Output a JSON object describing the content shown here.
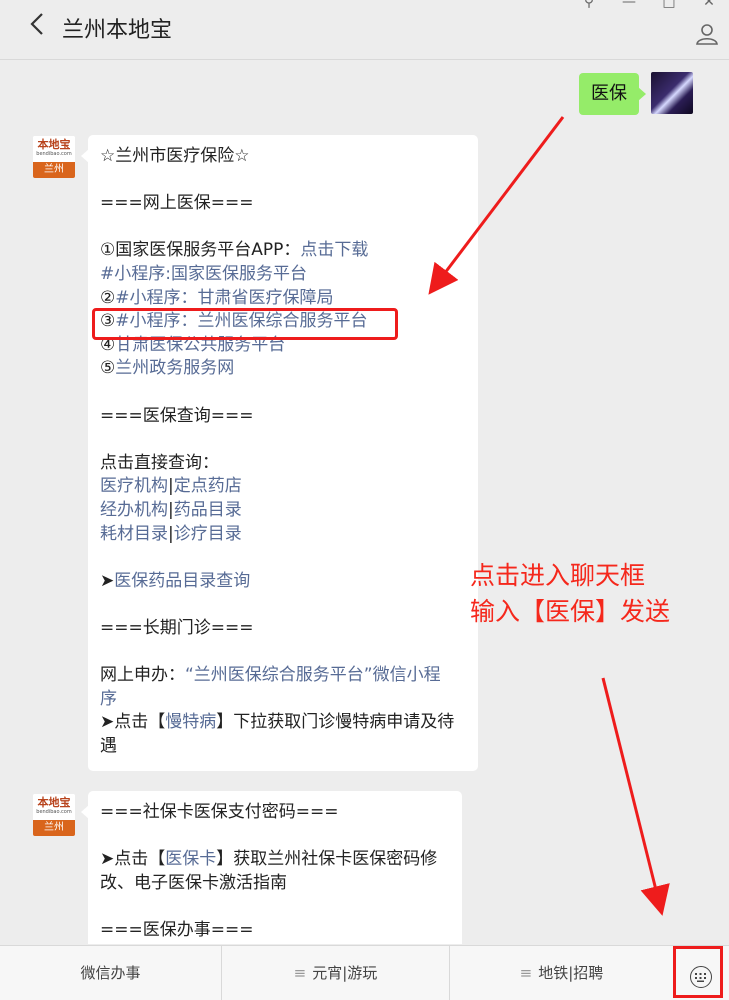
{
  "header": {
    "back_icon": "chevron-left-icon",
    "title": "兰州本地宝",
    "window_controls": [
      "pin-icon",
      "minimize-icon",
      "maximize-icon",
      "close-icon"
    ],
    "profile_icon": "user-icon"
  },
  "user_message": {
    "text": "医保"
  },
  "bot_avatar": {
    "top": "本地宝",
    "sub": "bendibao.com",
    "bottom": "兰州"
  },
  "message1": {
    "lines": [
      {
        "text": "☆兰州市医疗保险☆"
      },
      {
        "text": ""
      },
      {
        "text": "===网上医保==="
      },
      {
        "text": ""
      },
      {
        "prefix": "①国家医保服务平台APP：",
        "link": "点击下载"
      },
      {
        "link": "#小程序:国家医保服务平台"
      },
      {
        "prefix": "②",
        "link": "#小程序：甘肃省医疗保障局"
      },
      {
        "prefix": "③",
        "link": "#小程序：兰州医保综合服务平台"
      },
      {
        "prefix": "④",
        "link": "甘肃医保公共服务平台"
      },
      {
        "prefix": "⑤",
        "link": "兰州政务服务网"
      },
      {
        "text": ""
      },
      {
        "text": "===医保查询==="
      },
      {
        "text": ""
      },
      {
        "text": "点击直接查询："
      },
      {
        "link": "医疗机构",
        "sep": "|",
        "link2": "定点药店"
      },
      {
        "link": "经办机构",
        "sep": "|",
        "link2": "药品目录"
      },
      {
        "link": "耗材目录",
        "sep": "|",
        "link2": "诊疗目录"
      },
      {
        "text": ""
      },
      {
        "prefix": "➤",
        "link": "医保药品目录查询"
      },
      {
        "text": ""
      },
      {
        "text": "===长期门诊==="
      },
      {
        "text": ""
      },
      {
        "prefix": "网上申办：",
        "link": "“兰州医保综合服务平台”微信小程"
      },
      {
        "link": "序"
      },
      {
        "prefix": "➤点击【",
        "link": "慢特病",
        "suffix": "】下拉获取门诊慢特病申请及待"
      },
      {
        "text": "遇"
      }
    ]
  },
  "message2": {
    "lines": [
      {
        "text": "===社保卡医保支付密码==="
      },
      {
        "text": ""
      },
      {
        "prefix": "➤点击【",
        "link": "医保卡",
        "suffix": "】获取兰州社保卡医保密码修"
      },
      {
        "text": "改、电子医保卡激活指南"
      },
      {
        "text": ""
      },
      {
        "text": "===医保办事==="
      }
    ]
  },
  "annotation": {
    "line1": "点击进入聊天框",
    "line2": "输入【医保】发送"
  },
  "bottom_menu": {
    "items": [
      "微信办事",
      "元宵|游玩",
      "地铁|招聘"
    ],
    "menu_icon": "hamburger-icon",
    "keyboard_icon": "keyboard-icon"
  },
  "colors": {
    "link": "#576b95",
    "annotation": "#f5281c",
    "self_bubble": "#95ec69"
  }
}
